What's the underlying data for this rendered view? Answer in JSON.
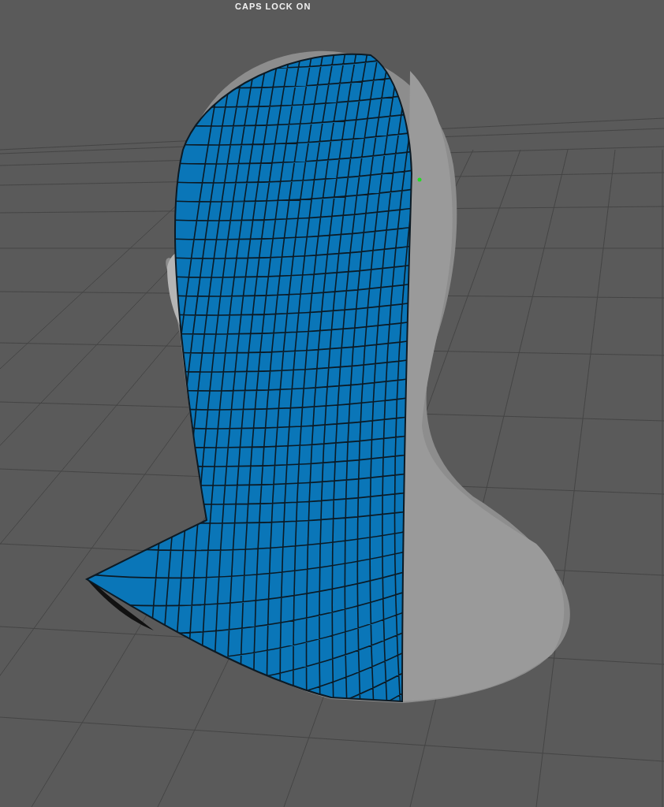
{
  "viewport": {
    "status_text": "CAPS LOCK ON"
  }
}
